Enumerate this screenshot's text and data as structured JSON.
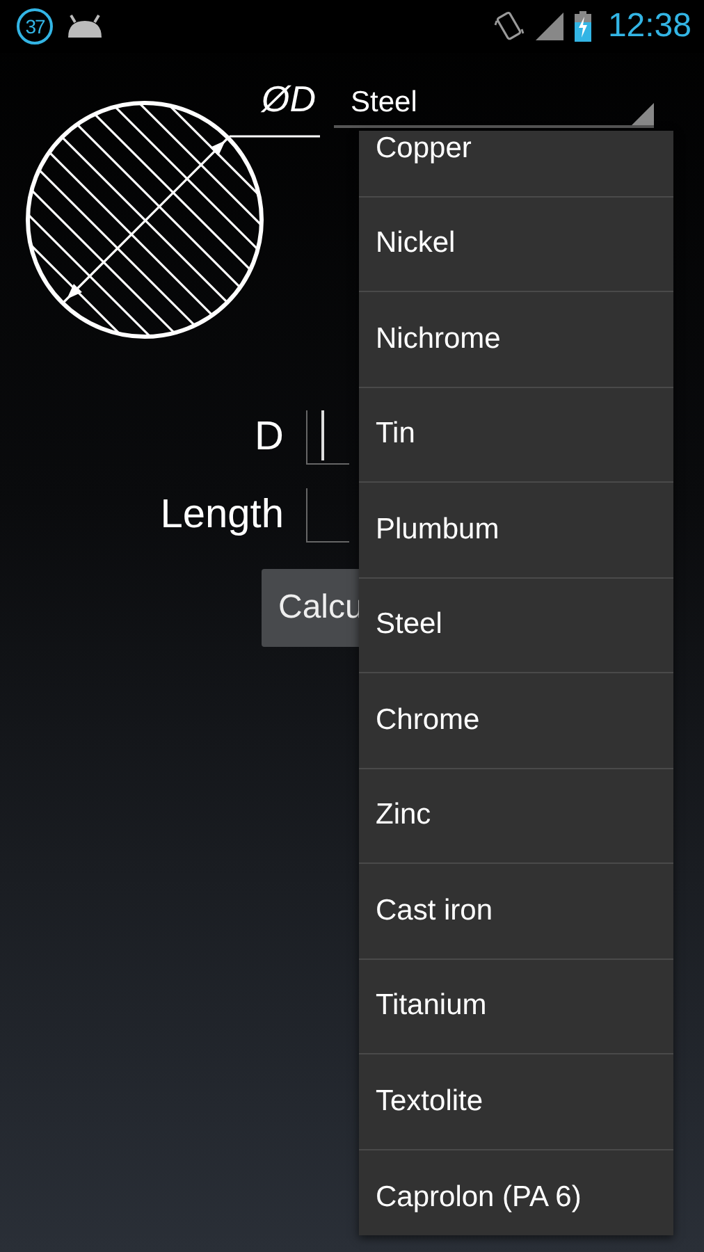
{
  "status_bar": {
    "notification_count": "37",
    "time": "12:38"
  },
  "diagram": {
    "label": "ØD"
  },
  "spinner": {
    "value": "Steel"
  },
  "form": {
    "fields": [
      {
        "label": "D",
        "focused": true
      },
      {
        "label": "Length",
        "focused": false
      }
    ],
    "button": "Calcu"
  },
  "dropdown": {
    "items": [
      {
        "label": "Copper"
      },
      {
        "label": "Nickel"
      },
      {
        "label": "Nichrome"
      },
      {
        "label": "Tin"
      },
      {
        "label": "Plumbum"
      },
      {
        "label": "Steel"
      },
      {
        "label": "Chrome"
      },
      {
        "label": "Zinc"
      },
      {
        "label": "Cast iron"
      },
      {
        "label": "Titanium"
      },
      {
        "label": "Textolite"
      },
      {
        "label": "Caprolon (PA 6)"
      }
    ]
  }
}
